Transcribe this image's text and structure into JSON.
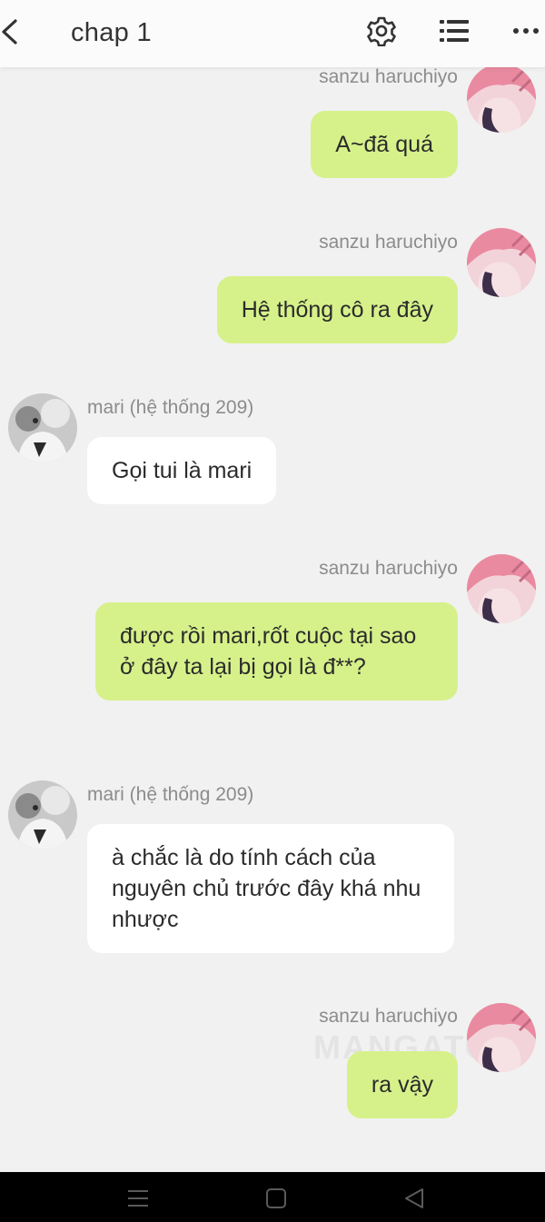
{
  "header": {
    "title": "chap 1",
    "icons": [
      "chevron-left-icon",
      "gear-icon",
      "list-icon",
      "more-icon"
    ]
  },
  "messages": [
    {
      "sender": "sanzu haruchiyo",
      "text": "A~đã quá"
    },
    {
      "sender": "sanzu haruchiyo",
      "text": "Hệ thống cô ra đây"
    },
    {
      "sender": "mari (hệ thống 209)",
      "text": "Gọi tui là mari"
    },
    {
      "sender": "sanzu haruchiyo",
      "text": "được rồi mari,rốt cuộc tại sao ở đây ta lại bị gọi là đ**?"
    },
    {
      "sender": "mari (hệ thống 209)",
      "text": "à chắc là do tính cách của nguyên chủ trước đây khá nhu nhược"
    },
    {
      "sender": "sanzu haruchiyo",
      "text": "ra vậy"
    }
  ],
  "watermark": "MANGATO",
  "navigation": {
    "icons": [
      "menu-icon",
      "home-icon",
      "back-triangle-icon"
    ]
  },
  "colors": {
    "my_bubble": "#d6f18a",
    "their_bubble": "#ffffff",
    "background": "#f1f1f1",
    "name_text": "#8c8c8c"
  }
}
